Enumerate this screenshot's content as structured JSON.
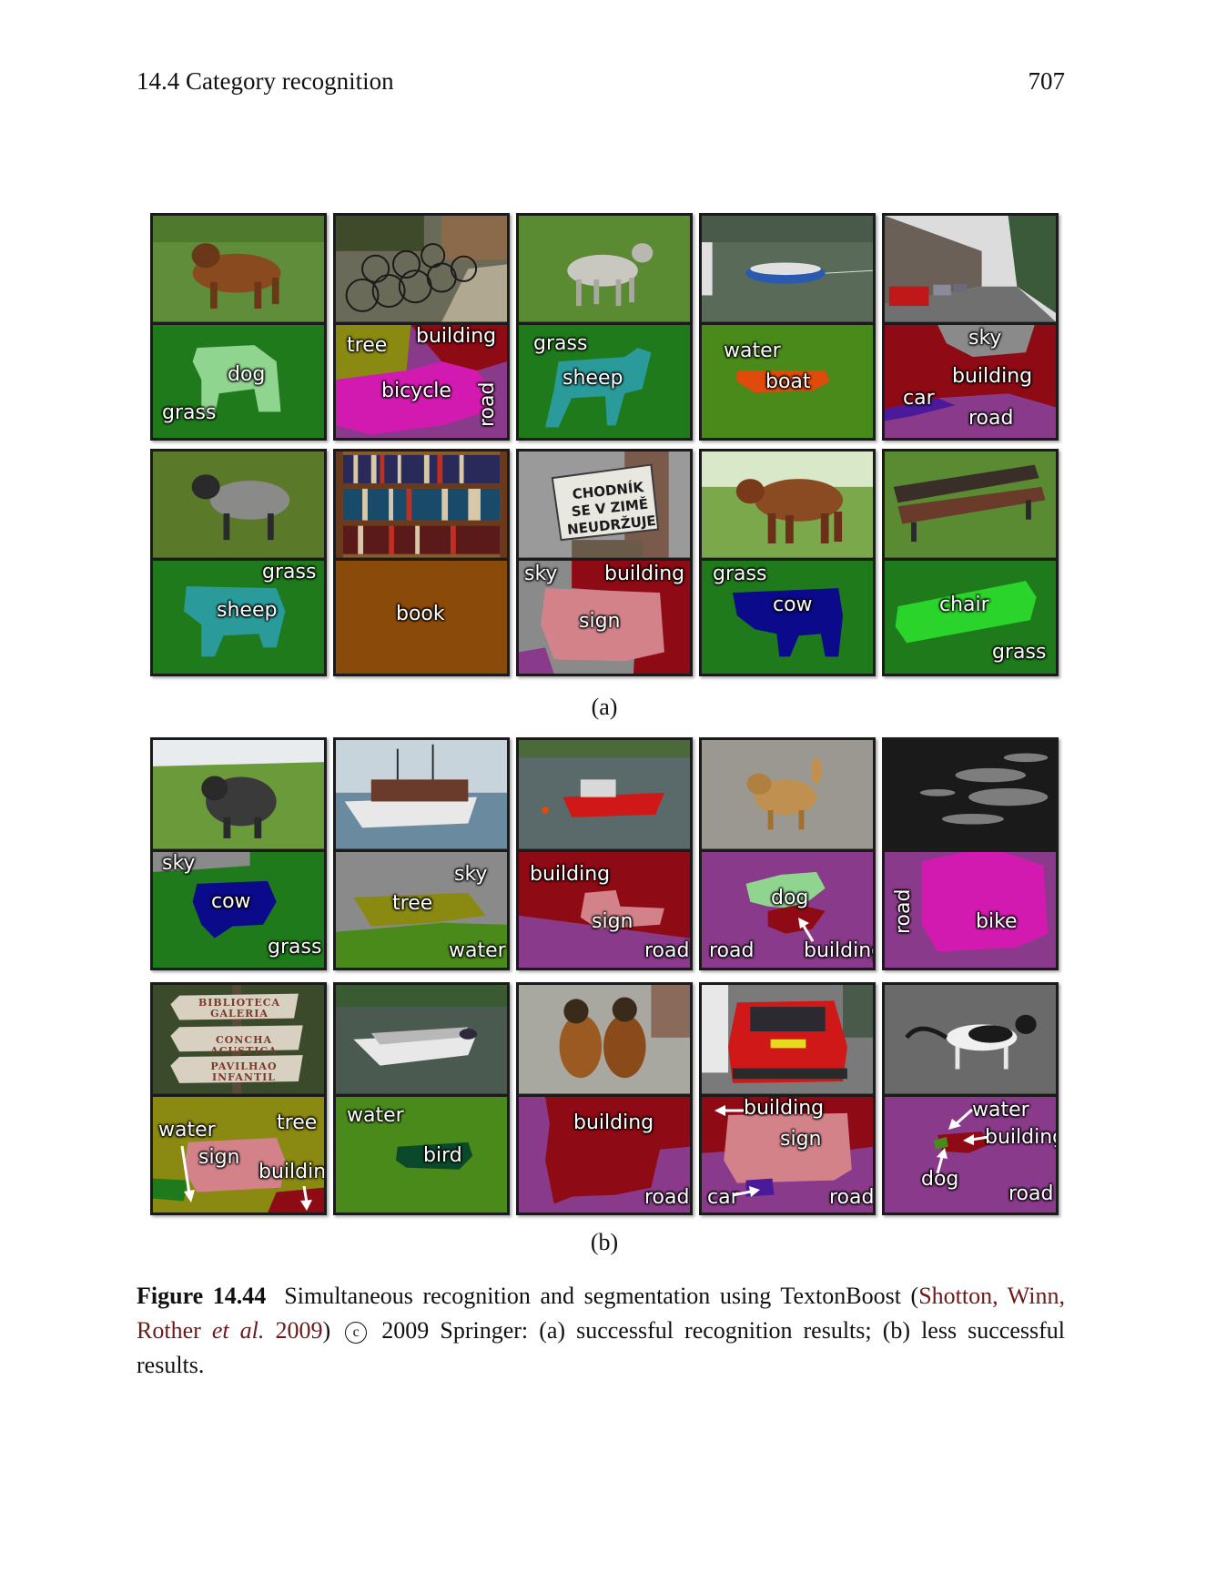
{
  "header": {
    "section": "14.4 Category recognition",
    "page_number": "707"
  },
  "colors": {
    "grass": "#1f7a1c",
    "tree": "#8a8a12",
    "building": "#8e0a14",
    "sky": "#8a8a8a",
    "road": "#8a3a8a",
    "bicycle": "#d21ab0",
    "bike": "#d21ab0",
    "dog": "#8fd48f",
    "sheep": "#2a9a9a",
    "water": "#4a8a1a",
    "boat": "#e04a0a",
    "car": "#4a1a9a",
    "book": "#8a4a0a",
    "sign": "#d4828a",
    "cow": "#0a0a8a",
    "chair": "#2ad42a",
    "bird": "#0a4a2a"
  },
  "panel_a": {
    "label": "(a)",
    "sign_photo_text": [
      "CHODNÍK",
      "SE V ZIMĚ",
      "NEUDRŽUJE"
    ],
    "cells": [
      {
        "name": "dog-grass",
        "labels": [
          "dog",
          "grass"
        ]
      },
      {
        "name": "bicycle-scene",
        "labels": [
          "tree",
          "building",
          "bicycle",
          "road"
        ]
      },
      {
        "name": "sheep-grass",
        "labels": [
          "grass",
          "sheep"
        ]
      },
      {
        "name": "boat-water",
        "labels": [
          "water",
          "boat"
        ]
      },
      {
        "name": "street-scene",
        "labels": [
          "sky",
          "building",
          "car",
          "road"
        ]
      },
      {
        "name": "sheep-grass-2",
        "labels": [
          "grass",
          "sheep"
        ]
      },
      {
        "name": "bookshelf",
        "labels": [
          "book"
        ]
      },
      {
        "name": "sign-scene",
        "labels": [
          "sky",
          "building",
          "sign"
        ]
      },
      {
        "name": "cow-grass",
        "labels": [
          "grass",
          "cow"
        ]
      },
      {
        "name": "bench-grass",
        "labels": [
          "chair",
          "grass"
        ]
      }
    ]
  },
  "panel_b": {
    "label": "(b)",
    "plaque_text": [
      "BIBLIOTECA",
      "GALERIA",
      "CONCHA ACUSTICA",
      "PAVILHAO",
      "INFANTIL"
    ],
    "cells": [
      {
        "name": "pig-scene",
        "labels": [
          "sky",
          "cow",
          "grass"
        ]
      },
      {
        "name": "ship-scene",
        "labels": [
          "sky",
          "tree",
          "water"
        ]
      },
      {
        "name": "red-boat-scene",
        "labels": [
          "building",
          "sign",
          "road"
        ]
      },
      {
        "name": "dog-road-scene",
        "labels": [
          "dog",
          "road",
          "building"
        ]
      },
      {
        "name": "water-sparkle-scene",
        "labels": [
          "road",
          "bike"
        ]
      },
      {
        "name": "signpost-scene",
        "labels": [
          "water",
          "tree",
          "sign",
          "building"
        ]
      },
      {
        "name": "white-boat-scene",
        "labels": [
          "water",
          "bird"
        ]
      },
      {
        "name": "two-dogs-scene",
        "labels": [
          "building",
          "road"
        ]
      },
      {
        "name": "red-car-scene",
        "labels": [
          "building",
          "sign",
          "car",
          "road"
        ]
      },
      {
        "name": "cat-scene",
        "labels": [
          "water",
          "building",
          "dog",
          "road"
        ]
      }
    ]
  },
  "caption": {
    "fig_num": "Figure 14.44",
    "text1": "Simultaneous recognition and segmentation using TextonBoost (",
    "cite1": "Shotton, Winn, Rother ",
    "etal": "et al.",
    "cite2": " 2009",
    "text2": ") ",
    "copyright_symbol": "c",
    "text3": " 2009 Springer: (a) successful recognition results; (b) less successful results."
  }
}
